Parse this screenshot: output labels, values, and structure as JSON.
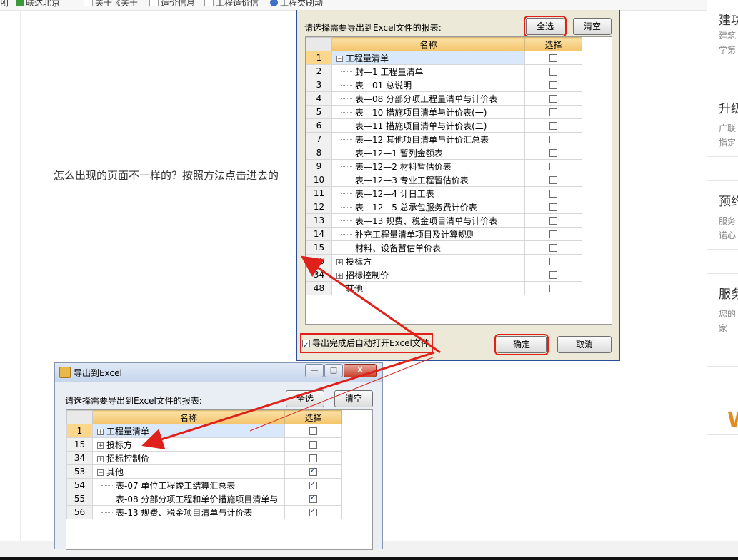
{
  "bookmarks": [
    {
      "label": "联达北京",
      "icon": "glodon-g-icon"
    },
    {
      "label": "关于《关于",
      "icon": "page-icon"
    },
    {
      "label": "造价信息",
      "icon": "page-icon"
    },
    {
      "label": "工程造价信",
      "icon": "page-icon"
    },
    {
      "label": "工程类刷动",
      "icon": "app-icon"
    }
  ],
  "question": "怎么出现的页面不一样的？按照方法点击进去的",
  "side_cards": [
    {
      "title": "建功",
      "desc": [
        "建筑",
        "学第"
      ]
    },
    {
      "title": "升级",
      "desc": [
        "广联",
        "指定"
      ]
    },
    {
      "title": "预约",
      "desc": [
        "服务",
        "诺心"
      ]
    },
    {
      "title": "服务",
      "desc": [
        "您的",
        "家"
      ]
    },
    {
      "title": "",
      "desc": [],
      "logo": "W"
    }
  ],
  "top_dialog": {
    "prompt": "请选择需要导出到Excel文件的报表:",
    "select_all": "全选",
    "clear": "清空",
    "col_name": "名称",
    "col_select": "选择",
    "rows": [
      {
        "num": "1",
        "name": "工程量清单",
        "level": 0,
        "expander": "−",
        "checked": false,
        "selected": true
      },
      {
        "num": "2",
        "name": "封—1  工程量清单",
        "level": 1,
        "checked": false
      },
      {
        "num": "3",
        "name": "表—01  总说明",
        "level": 1,
        "checked": false
      },
      {
        "num": "4",
        "name": "表—08  分部分项工程量清单与计价表",
        "level": 1,
        "checked": false
      },
      {
        "num": "5",
        "name": "表—10  措施项目清单与计价表(一)",
        "level": 1,
        "checked": false
      },
      {
        "num": "6",
        "name": "表—11  措施项目清单与计价表(二)",
        "level": 1,
        "checked": false
      },
      {
        "num": "7",
        "name": "表—12  其他项目清单与计价汇总表",
        "level": 1,
        "checked": false
      },
      {
        "num": "8",
        "name": "表—12—1  暂列金额表",
        "level": 1,
        "checked": false
      },
      {
        "num": "9",
        "name": "表—12—2  材料暂估价表",
        "level": 1,
        "checked": false
      },
      {
        "num": "10",
        "name": "表—12—3  专业工程暂估价表",
        "level": 1,
        "checked": false
      },
      {
        "num": "11",
        "name": "表—12—4  计日工表",
        "level": 1,
        "checked": false
      },
      {
        "num": "12",
        "name": "表—12—5  总承包服务费计价表",
        "level": 1,
        "checked": false
      },
      {
        "num": "13",
        "name": "表—13  规费、税金项目清单与计价表",
        "level": 1,
        "checked": false
      },
      {
        "num": "14",
        "name": "补充工程量清单项目及计算规则",
        "level": 1,
        "checked": false
      },
      {
        "num": "15",
        "name": "材料、设备暂估单价表",
        "level": 1,
        "checked": false
      },
      {
        "num": "16",
        "name": "投标方",
        "level": 0,
        "expander": "+",
        "checked": false
      },
      {
        "num": "34",
        "name": "招标控制价",
        "level": 0,
        "expander": "+",
        "checked": false
      },
      {
        "num": "48",
        "name": "其他",
        "level": 0,
        "expander": "",
        "checked": false
      }
    ],
    "auto_open": "导出完成后自动打开Excel文件",
    "auto_open_checked": true,
    "ok": "确定",
    "cancel": "取消"
  },
  "bottom_dialog": {
    "title": "导出到Excel",
    "minimize": "—",
    "maximize": "□",
    "close": "X",
    "prompt": "请选择需要导出到Excel文件的报表:",
    "select_all": "全选",
    "clear": "清空",
    "col_name": "名称",
    "col_select": "选择",
    "rows": [
      {
        "num": "1",
        "name": "工程量清单",
        "level": 0,
        "expander": "+",
        "checked": false,
        "selected": true
      },
      {
        "num": "15",
        "name": "投标方",
        "level": 0,
        "expander": "+",
        "checked": false
      },
      {
        "num": "34",
        "name": "招标控制价",
        "level": 0,
        "expander": "+",
        "checked": false
      },
      {
        "num": "53",
        "name": "其他",
        "level": 0,
        "expander": "−",
        "checked": true
      },
      {
        "num": "54",
        "name": "表-07  单位工程竣工结算汇总表",
        "level": 1,
        "checked": true
      },
      {
        "num": "55",
        "name": "表-08  分部分项工程和单价措施项目清单与",
        "level": 1,
        "checked": true
      },
      {
        "num": "56",
        "name": "表-13  规费、税金项目清单与计价表",
        "level": 1,
        "checked": true
      }
    ]
  },
  "colors": {
    "annotation_red": "#e0201a",
    "header_orange": "#f3c46a"
  }
}
